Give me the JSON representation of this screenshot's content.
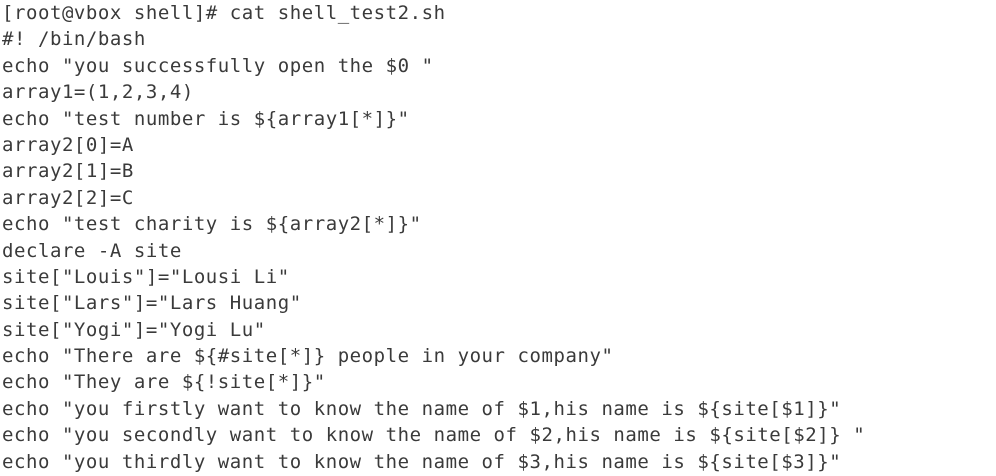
{
  "terminal": {
    "lines": [
      "[root@vbox shell]# cat shell_test2.sh",
      "#! /bin/bash",
      "echo \"you successfully open the $0 \"",
      "array1=(1,2,3,4)",
      "echo \"test number is ${array1[*]}\"",
      "array2[0]=A",
      "array2[1]=B",
      "array2[2]=C",
      "echo \"test charity is ${array2[*]}\"",
      "declare -A site",
      "site[\"Louis\"]=\"Lousi Li\"",
      "site[\"Lars\"]=\"Lars Huang\"",
      "site[\"Yogi\"]=\"Yogi Lu\"",
      "echo \"There are ${#site[*]} people in your company\"",
      "echo \"They are ${!site[*]}\"",
      "echo \"you firstly want to know the name of $1,his name is ${site[$1]}\"",
      "echo \"you secondly want to know the name of $2,his name is ${site[$2]} \"",
      "echo \"you thirdly want to know the name of $3,his name is ${site[$3]}\""
    ]
  }
}
